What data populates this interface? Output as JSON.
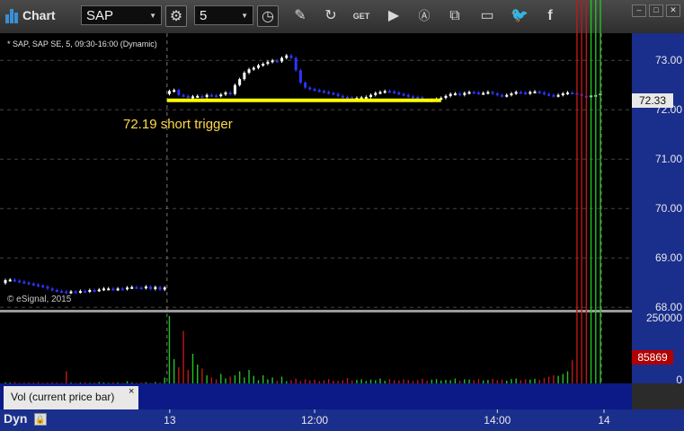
{
  "window": {
    "title": "Chart",
    "symbol": "SAP",
    "interval": "5",
    "controls": [
      "minimize-icon",
      "maximize-icon",
      "close-icon"
    ]
  },
  "toolbar": {
    "icons": [
      "settings-icon",
      "clock-icon",
      "pencil-icon",
      "refresh-icon",
      "get-icon",
      "play-icon",
      "alert-icon",
      "link-icon",
      "comment-icon",
      "twitter-icon",
      "facebook-icon"
    ]
  },
  "chart": {
    "header": "* SAP, SAP SE, 5, 09:30-16:00 (Dynamic)",
    "watermark": "© eSignal, 2015",
    "annotation": "72.19 short trigger",
    "last_price_label": "72.33",
    "volume_label": "85869",
    "study_label": "Vol (current price bar)",
    "study_close": "×",
    "footer_mode": "Dyn",
    "colors": {
      "background": "#000000",
      "axis": "#1a2e8c",
      "up": "#ffffff",
      "down": "#2b35ff",
      "trigger": "#ffff00",
      "vol_up": "#22c422",
      "vol_down": "#c01818"
    }
  },
  "chart_data": {
    "type": "candlestick",
    "price_axis": {
      "ticks": [
        "73.00",
        "72.00",
        "71.00",
        "70.00",
        "69.00",
        "68.00"
      ],
      "ylim": [
        67.95,
        73.55
      ]
    },
    "volume_axis": {
      "ticks": [
        "250000",
        "0"
      ],
      "ylim": [
        0,
        250000
      ]
    },
    "time_axis": {
      "ticks": [
        "13",
        "12:00",
        "14:00",
        "14"
      ]
    },
    "trigger_level": 72.19,
    "price_series": [
      68.55,
      68.56,
      68.54,
      68.52,
      68.5,
      68.48,
      68.46,
      68.44,
      68.42,
      68.38,
      68.35,
      68.33,
      68.32,
      68.3,
      68.32,
      68.31,
      68.33,
      68.32,
      68.35,
      68.34,
      68.36,
      68.38,
      68.38,
      68.36,
      68.38,
      68.37,
      68.4,
      68.41,
      68.4,
      68.39,
      68.42,
      68.37,
      68.41,
      68.36,
      68.4,
      72.38,
      72.4,
      72.3,
      72.28,
      72.25,
      72.27,
      72.28,
      72.26,
      72.3,
      72.29,
      72.28,
      72.31,
      72.35,
      72.32,
      72.5,
      72.62,
      72.75,
      72.82,
      72.85,
      72.9,
      72.93,
      72.97,
      73.0,
      72.98,
      73.05,
      73.1,
      73.05,
      72.8,
      72.55,
      72.45,
      72.42,
      72.4,
      72.38,
      72.36,
      72.34,
      72.32,
      72.28,
      72.26,
      72.25,
      72.24,
      72.24,
      72.25,
      72.26,
      72.3,
      72.34,
      72.36,
      72.38,
      72.37,
      72.35,
      72.32,
      72.3,
      72.27,
      72.26,
      72.25,
      72.2,
      72.18,
      72.2,
      72.22,
      72.24,
      72.28,
      72.32,
      72.33,
      72.3,
      72.34,
      72.36,
      72.35,
      72.33,
      72.34,
      72.36,
      72.33,
      72.3,
      72.28,
      72.3,
      72.33,
      72.36,
      72.35,
      72.33,
      72.36,
      72.37,
      72.35,
      72.32,
      72.3,
      72.28,
      72.3,
      72.33,
      72.35,
      72.34,
      72.32,
      72.28,
      72.27,
      72.29,
      72.3,
      72.33
    ],
    "volume_series": [
      4000,
      3000,
      5000,
      2000,
      3000,
      4000,
      3000,
      5000,
      2000,
      3000,
      4000,
      3000,
      2000,
      45000,
      3000,
      2000,
      3000,
      4000,
      2000,
      3000,
      5000,
      3000,
      2000,
      4000,
      3000,
      2000,
      8000,
      3000,
      2000,
      3000,
      4000,
      2000,
      5000,
      3000,
      22000,
      250000,
      90000,
      60000,
      195000,
      50000,
      110000,
      70000,
      55000,
      30000,
      22000,
      15000,
      35000,
      18000,
      25000,
      30000,
      45000,
      22000,
      50000,
      28000,
      12000,
      30000,
      15000,
      22000,
      10000,
      25000,
      8000,
      12000,
      18000,
      9000,
      15000,
      11000,
      14000,
      8000,
      12000,
      16000,
      10000,
      9000,
      12000,
      20000,
      11000,
      13000,
      15000,
      9000,
      14000,
      12000,
      18000,
      10000,
      16000,
      12000,
      11000,
      15000,
      13000,
      9000,
      12000,
      17000,
      10000,
      14000,
      16000,
      11000,
      13000,
      12000,
      18000,
      10000,
      15000,
      14000,
      12000,
      16000,
      11000,
      13000,
      17000,
      12000,
      14000,
      10000,
      16000,
      18000,
      12000,
      15000,
      14000,
      17000,
      13000,
      20000,
      25000,
      30000,
      28000,
      35000,
      45000,
      85869
    ]
  }
}
